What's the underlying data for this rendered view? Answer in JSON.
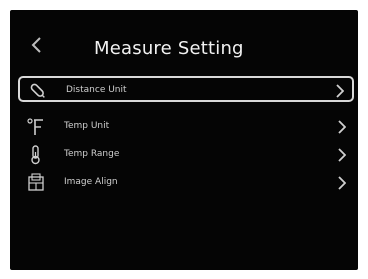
{
  "header": {
    "title": "Measure Setting"
  },
  "menu": {
    "items": [
      {
        "label": "Distance Unit",
        "icon": "pencil-icon",
        "selected": true
      },
      {
        "label": "Temp Unit",
        "icon": "temperature-unit-icon",
        "selected": false
      },
      {
        "label": "Temp Range",
        "icon": "thermometer-icon",
        "selected": false
      },
      {
        "label": "Image Align",
        "icon": "image-align-icon",
        "selected": false
      }
    ]
  },
  "colors": {
    "background": "#050505",
    "text": "#f2f2f2",
    "selection_border": "#d9d9d9"
  }
}
